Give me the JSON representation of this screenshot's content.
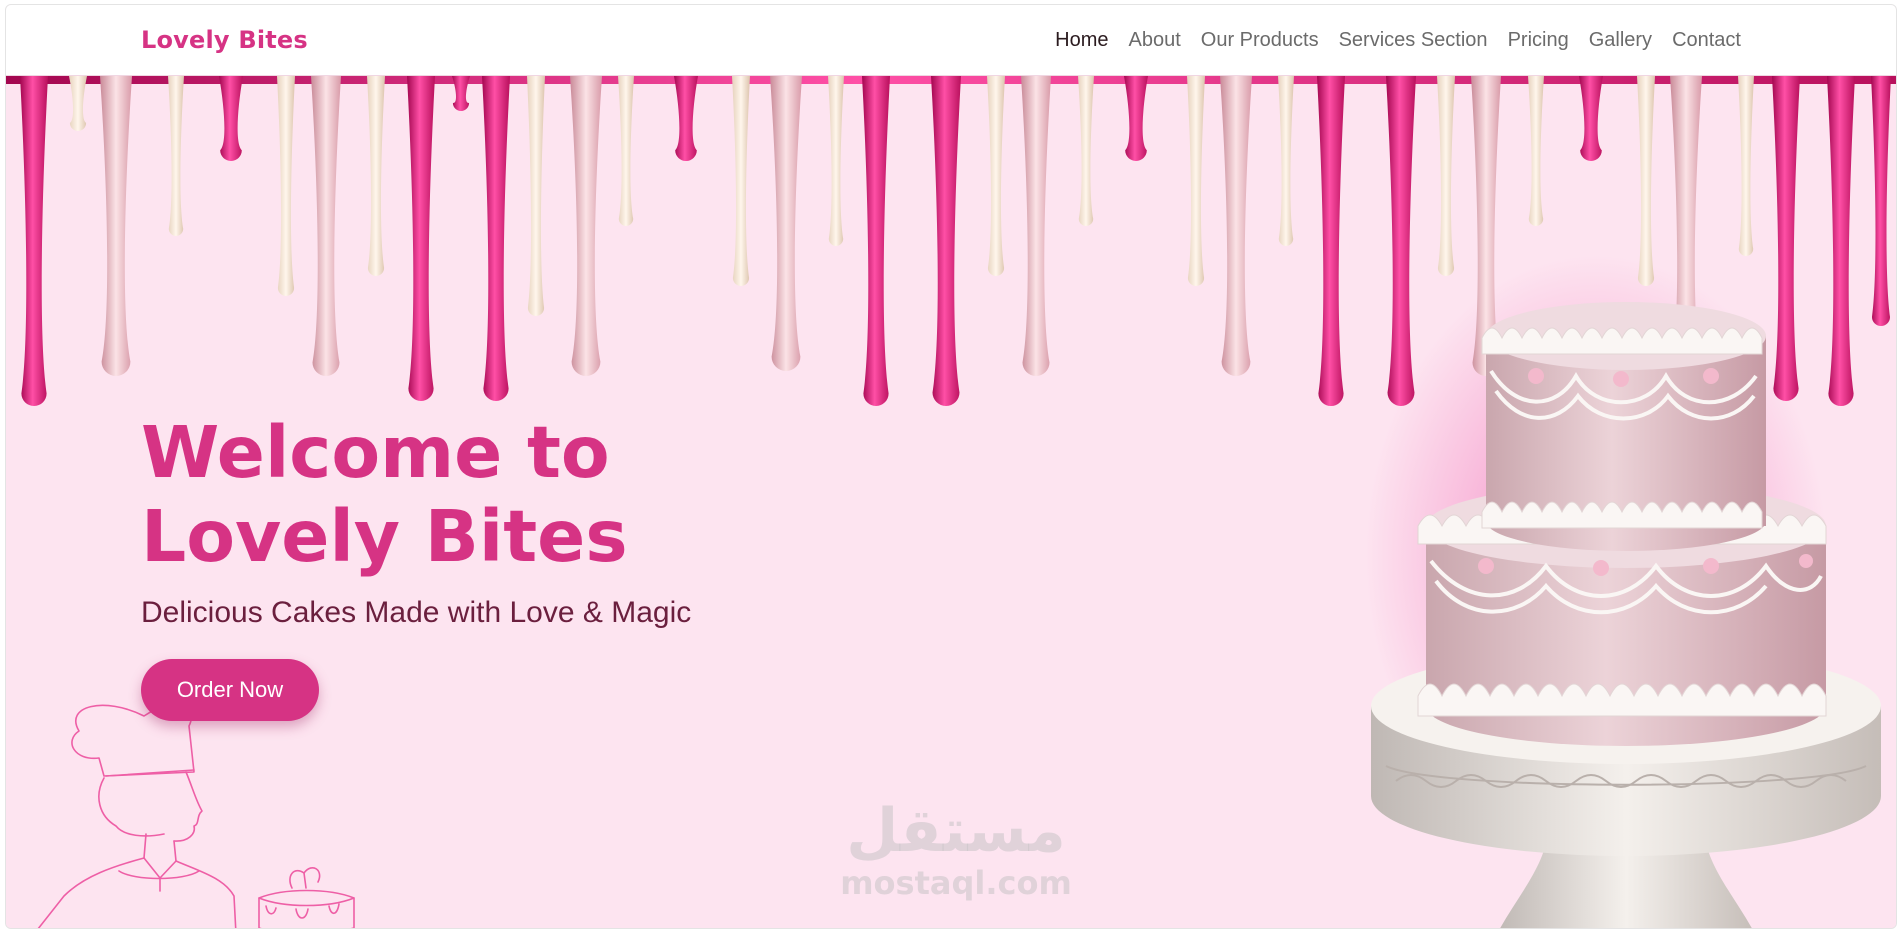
{
  "brand": {
    "name": "Lovely Bites",
    "color": "#d63384"
  },
  "nav": {
    "items": [
      {
        "label": "Home",
        "active": true
      },
      {
        "label": "About",
        "active": false
      },
      {
        "label": "Our Products",
        "active": false
      },
      {
        "label": "Services Section",
        "active": false
      },
      {
        "label": "Pricing",
        "active": false
      },
      {
        "label": "Gallery",
        "active": false
      },
      {
        "label": "Contact",
        "active": false
      }
    ]
  },
  "hero": {
    "title": "Welcome to Lovely Bites",
    "subtitle": "Delicious Cakes Made with Love & Magic",
    "cta_label": "Order Now",
    "images": [
      "icing-drips",
      "chef-line-art",
      "tiered-cake"
    ]
  },
  "watermark": {
    "arabic": "مستقل",
    "latin": "mostaql.com"
  },
  "colors": {
    "accent": "#d63384",
    "background": "#fde4f0",
    "subtitle": "#6b1f3e"
  }
}
